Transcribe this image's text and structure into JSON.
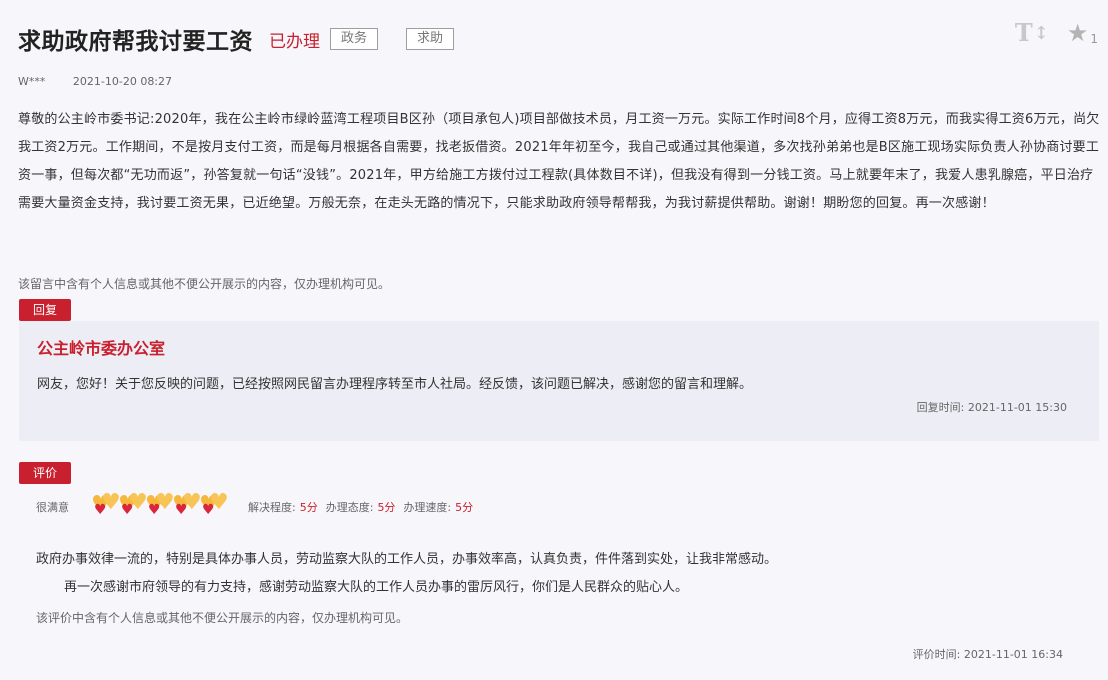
{
  "header": {
    "title": "求助政府帮我讨要工资",
    "status": "已办理",
    "tags": [
      "政务",
      "求助"
    ],
    "font_tool": "T",
    "font_tool_arrows": "↕",
    "star_count": "1"
  },
  "meta": {
    "author": "W***",
    "date": "2021-10-20 08:27"
  },
  "content": "尊敬的公主岭市委书记:2020年，我在公主岭市绿岭蓝湾工程项目B区孙（项目承包人)项目部做技术员，月工资一万元。实际工作时间8个月，应得工资8万元，而我实得工资6万元，尚欠我工资2万元。工作期间，不是按月支付工资，而是每月根据各自需要，找老扳借资。2021年年初至今，我自己或通过其他渠道，多次找孙弟弟也是B区施工现场实际负责人孙协商讨要工资一事，但每次都“无功而返”，孙答复就一句话“没钱”。2021年，甲方给施工方拨付过工程款(具体数目不详)，但我没有得到一分钱工资。马上就要年末了，我爱人患乳腺癌，平日治疗需要大量资金支持，我讨要工资无果，已近绝望。万般无奈，在走头无路的情况下，只能求助政府领导帮帮我，为我讨薪提供帮助。谢谢！期盼您的回复。再一次感谢！",
  "privacy_notice": "该留言中含有个人信息或其他不便公开展示的内容，仅办理机构可见。",
  "reply": {
    "label": "回复",
    "org": "公主岭市委办公室",
    "text": "网友，您好！关于您反映的问题，已经按照网民留言办理程序转至市人社局。经反馈，该问题已解决，感谢您的留言和理解。",
    "time_label": "回复时间:",
    "time": "2021-11-01 15:30"
  },
  "evaluation": {
    "label": "评价",
    "satisfaction": "很满意",
    "hearts": 5,
    "scores": [
      {
        "label": "解决程度:",
        "value": "5分"
      },
      {
        "label": "办理态度:",
        "value": "5分"
      },
      {
        "label": "办理速度:",
        "value": "5分"
      }
    ],
    "text_1": "政府办事效律一流的，特别是具体办事人员，劳动监察大队的工作人员，办事效率高，认真负责，件件落到实处，让我非常感动。",
    "text_2": "再一次感谢市府领导的有力支持，感谢劳动监察大队的工作人员办事的雷厉风行，你们是人民群众的贴心人。",
    "privacy_notice": "该评价中含有个人信息或其他不便公开展示的内容，仅办理机构可见。",
    "time_label": "评价时间:",
    "time": "2021-11-01 16:34"
  },
  "colors": {
    "accent": "#c8202e",
    "reply_bg": "#edeef5",
    "page_bg": "#f7f6fa"
  }
}
